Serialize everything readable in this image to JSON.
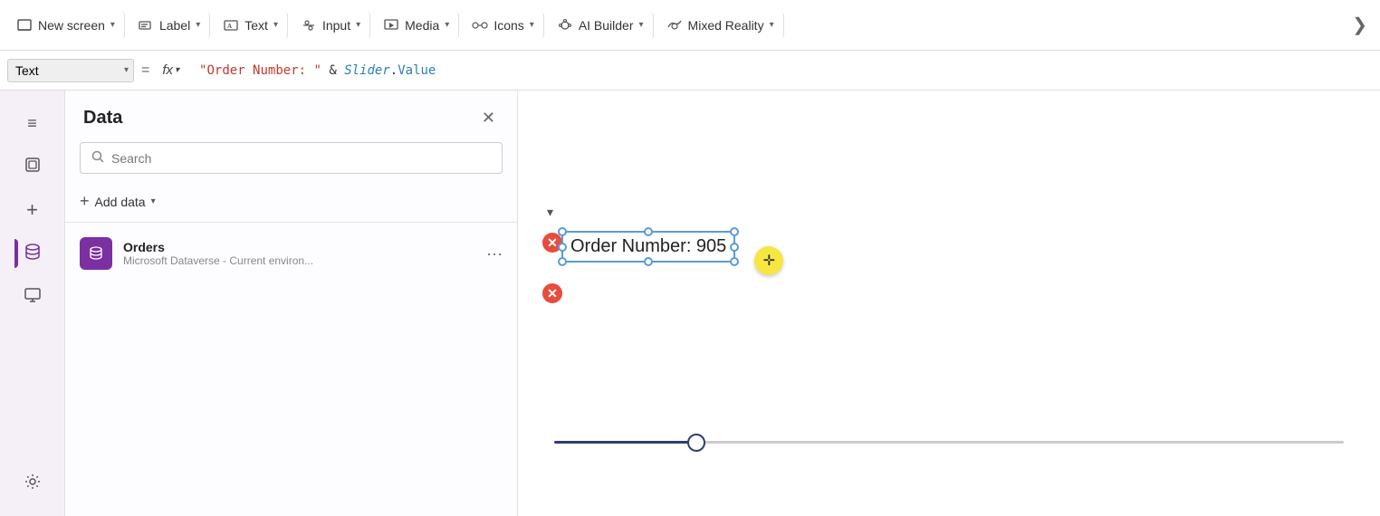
{
  "toolbar": {
    "new_screen_label": "New screen",
    "new_screen_chevron": "▾",
    "label_label": "Label",
    "label_chevron": "▾",
    "text_label": "Text",
    "text_chevron": "▾",
    "input_label": "Input",
    "input_chevron": "▾",
    "media_label": "Media",
    "media_chevron": "▾",
    "icons_label": "Icons",
    "icons_chevron": "▾",
    "ai_builder_label": "AI Builder",
    "ai_builder_chevron": "▾",
    "mixed_reality_label": "Mixed Reality",
    "mixed_reality_chevron": "▾",
    "more_icon": "❯"
  },
  "formula_bar": {
    "property_label": "Text",
    "equals_sign": "=",
    "fx_label": "fx",
    "formula_text": "\"Order Number: \" & Slider.Value"
  },
  "sidebar": {
    "icons": [
      {
        "name": "menu-icon",
        "symbol": "≡",
        "active": false
      },
      {
        "name": "layers-icon",
        "symbol": "⧉",
        "active": false
      },
      {
        "name": "add-icon",
        "symbol": "+",
        "active": false
      },
      {
        "name": "database-icon",
        "symbol": "🗄",
        "active": true
      },
      {
        "name": "monitor-icon",
        "symbol": "🖥",
        "active": false
      },
      {
        "name": "settings-icon",
        "symbol": "⚙",
        "active": false
      }
    ]
  },
  "data_panel": {
    "title": "Data",
    "search_placeholder": "Search",
    "add_data_label": "Add data",
    "add_data_chevron": "▾",
    "items": [
      {
        "name": "Orders",
        "subtitle": "Microsoft Dataverse - Current environ...",
        "icon": "🗄"
      }
    ]
  },
  "canvas": {
    "text_element": "Order Number: 905",
    "formula_display": "\"Order Number: \" & Slider.Value",
    "slider_value": 905,
    "delete_badge": "✕",
    "delete_badge2": "✕"
  }
}
